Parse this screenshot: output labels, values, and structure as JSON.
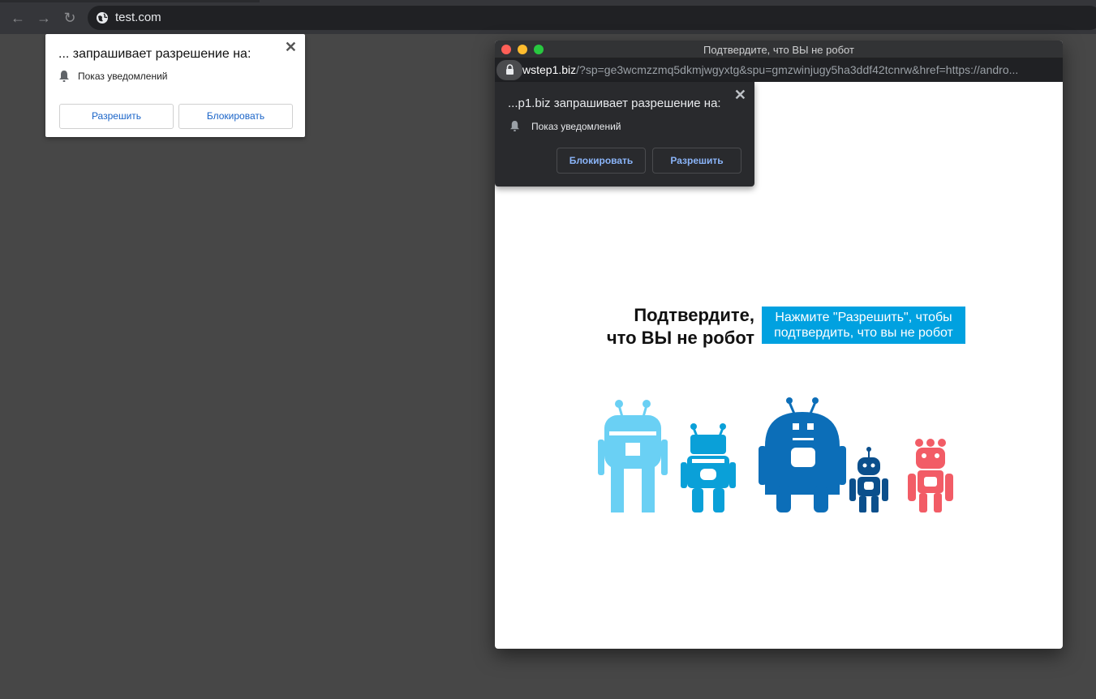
{
  "browser": {
    "url": "test.com",
    "nav": {
      "back": "←",
      "forward": "→",
      "reload": "↻"
    }
  },
  "permission_prompt": {
    "title": "... запрашивает разрешение на:",
    "permission": "Показ уведомлений",
    "allow_label": "Разрешить",
    "block_label": "Блокировать",
    "close": "✕"
  },
  "popup": {
    "window_title": "Подтвердите, что ВЫ не робот",
    "url_domain": "wstep1.biz",
    "url_rest": "/?sp=ge3wcmzzmq5dkmjwgyxtg&spu=gmzwinjugy5ha3ddf42tcnrw&href=https://andro...",
    "prompt": {
      "title": "...p1.biz запрашивает разрешение на:",
      "permission": "Показ уведомлений",
      "block_label": "Блокировать",
      "allow_label": "Разрешить",
      "close": "✕"
    },
    "page": {
      "headline_line1": "Подтвердите,",
      "headline_line2": "что ВЫ не робот",
      "cta_line1": "Нажмите \"Разрешить\", чтобы",
      "cta_line2": "подтвердить, что вы не робот"
    }
  },
  "colors": {
    "robot_light_blue": "#6ad0f4",
    "robot_blue": "#0aa0d8",
    "robot_dark_blue": "#0c6eb8",
    "robot_navy": "#0b4f8c",
    "robot_red": "#f25c66",
    "cta_bg": "#00a1e0"
  }
}
